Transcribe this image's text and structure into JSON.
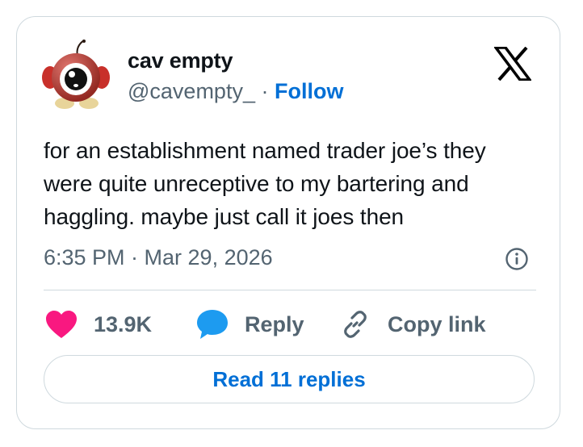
{
  "author": {
    "name": "cav empty",
    "handle": "@cavempty_",
    "separator": "·",
    "follow_label": "Follow"
  },
  "tweet": {
    "text": "for an establishment named trader joe’s they were quite unreceptive to my bartering and haggling. maybe just call it joes then",
    "timestamp": "6:35 PM · Mar 29, 2026"
  },
  "actions": {
    "likes_count": "13.9K",
    "reply_label": "Reply",
    "copy_link_label": "Copy link"
  },
  "read_replies_label": "Read 11 replies",
  "icons": {
    "platform": "x-logo-icon",
    "info": "info-icon",
    "like": "heart-icon",
    "reply": "speech-bubble-icon",
    "copy": "link-icon"
  },
  "colors": {
    "like": "#f91880",
    "reply": "#1d9bf0",
    "link": "#006fd6",
    "muted": "#536471",
    "text": "#0f1419",
    "border": "#cfd9de"
  }
}
